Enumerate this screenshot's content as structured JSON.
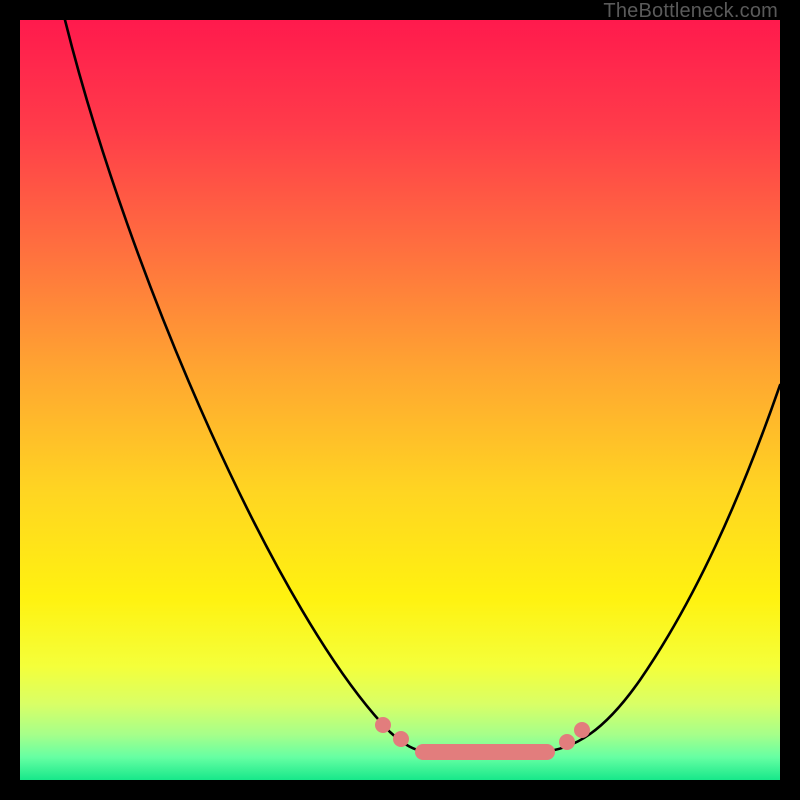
{
  "watermark": "TheBottleneck.com",
  "colors": {
    "gradient_top": "#ff1a4d",
    "gradient_mid_orange": "#ffa531",
    "gradient_mid_yellow": "#fff210",
    "gradient_bottom": "#17e88a",
    "curve": "#000000",
    "marker": "#e27d7d",
    "frame_bg": "#000000"
  },
  "chart_data": {
    "type": "line",
    "title": "",
    "xlabel": "",
    "ylabel": "",
    "ylim": [
      0,
      100
    ],
    "xlim": [
      0,
      100
    ],
    "background_gradient_stops": [
      {
        "pos": 0.0,
        "color": "#ff1a4d"
      },
      {
        "pos": 0.14,
        "color": "#ff3b4a"
      },
      {
        "pos": 0.3,
        "color": "#ff6f3f"
      },
      {
        "pos": 0.46,
        "color": "#ffa531"
      },
      {
        "pos": 0.62,
        "color": "#ffd522"
      },
      {
        "pos": 0.76,
        "color": "#fff210"
      },
      {
        "pos": 0.85,
        "color": "#f4ff3a"
      },
      {
        "pos": 0.9,
        "color": "#d9ff66"
      },
      {
        "pos": 0.94,
        "color": "#a6ff8a"
      },
      {
        "pos": 0.97,
        "color": "#66ffa3"
      },
      {
        "pos": 1.0,
        "color": "#17e88a"
      }
    ],
    "series": [
      {
        "name": "bottleneck-curve",
        "x": [
          6,
          10,
          15,
          20,
          25,
          30,
          35,
          40,
          45,
          48,
          52,
          55,
          60,
          65,
          68,
          72,
          76,
          80,
          85,
          90,
          95,
          100
        ],
        "y": [
          100,
          88,
          76,
          65,
          55,
          45,
          36,
          28,
          18,
          10,
          5,
          4,
          4,
          4,
          4,
          5,
          8,
          14,
          22,
          33,
          44,
          52
        ]
      }
    ],
    "markers": {
      "name": "optimal-range",
      "color": "#e27d7d",
      "points": [
        {
          "x": 48,
          "y": 7
        },
        {
          "x": 50,
          "y": 5
        },
        {
          "x": 53,
          "y": 4
        },
        {
          "x": 58,
          "y": 4
        },
        {
          "x": 63,
          "y": 4
        },
        {
          "x": 68,
          "y": 4
        },
        {
          "x": 72,
          "y": 5
        },
        {
          "x": 74,
          "y": 7
        }
      ]
    },
    "annotations": [
      {
        "text": "TheBottleneck.com",
        "position": "top-right"
      }
    ]
  }
}
